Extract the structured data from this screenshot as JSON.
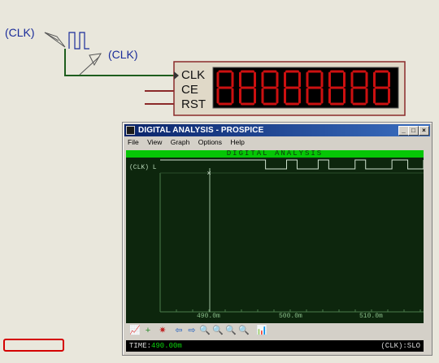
{
  "schematic": {
    "generator_label": "(CLK)",
    "probe_label": "(CLK)",
    "counter_pins": [
      "CLK",
      "CE",
      "RST"
    ],
    "display_digits": 8,
    "segment_color": "#cc1010"
  },
  "window": {
    "title": "DIGITAL ANALYSIS - PROSPICE",
    "controls": {
      "minimize": "_",
      "maximize": "□",
      "close": "×"
    },
    "menu": [
      "File",
      "View",
      "Graph",
      "Options",
      "Help"
    ]
  },
  "graph": {
    "header": "DIGITAL ANALYSIS",
    "trace_label": "(CLK) L",
    "x_ticks": [
      "490.0m",
      "500.0m",
      "510.0m"
    ],
    "cursor_marker": "×"
  },
  "toolbar": {
    "icons": [
      "graph-icon",
      "add-trace-icon",
      "simulate-icon",
      "arrow-left-icon",
      "arrow-right-icon",
      "zoom-in-icon",
      "zoom-out-icon",
      "zoom-all-icon",
      "zoom-area-icon",
      "chart-icon"
    ]
  },
  "status": {
    "time_label": "TIME:",
    "time_value": "490.00m",
    "trace_status": "(CLK):SLO"
  },
  "colors": {
    "wire": "#1e5e1e",
    "scope_bg": "#0d260d",
    "scope_header": "#06c606",
    "trace": "#cfe3cf",
    "highlight": "#d40000"
  },
  "chart_data": {
    "type": "line",
    "title": "DIGITAL ANALYSIS",
    "xlabel": "",
    "ylabel": "",
    "series": [
      {
        "name": "(CLK)",
        "steps": [
          [
            0,
            1
          ],
          [
            0.4,
            0
          ],
          [
            0.48,
            1
          ],
          [
            0.52,
            0
          ],
          [
            0.6,
            1
          ],
          [
            0.64,
            0
          ],
          [
            0.74,
            1
          ],
          [
            0.78,
            0
          ],
          [
            0.88,
            1
          ],
          [
            0.94,
            0
          ],
          [
            1,
            1
          ]
        ]
      }
    ]
  }
}
